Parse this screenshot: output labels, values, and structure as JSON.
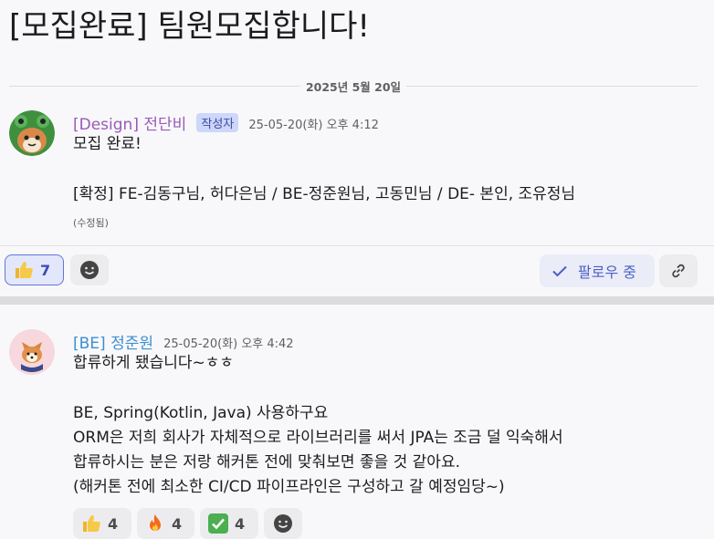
{
  "page": {
    "title": "[모집완료] 팀원모집합니다!"
  },
  "date_divider": "2025년 5월 20일",
  "messages": [
    {
      "author": "[Design] 전단비",
      "badge": "작성자",
      "time": "25-05-20(화) 오후 4:12",
      "lines": [
        "모집 완료!",
        "",
        "[확정] FE-김동구님, 허다은님 / BE-정준원님, 고동민님 / DE- 본인, 조유정님"
      ],
      "edited": "(수정됨)",
      "reactions": [
        {
          "emoji": "thumbs-up",
          "count": "7",
          "active": true
        }
      ],
      "follow_label": "팔로우 중"
    },
    {
      "author": "[BE] 정준원",
      "time": "25-05-20(화) 오후 4:42",
      "lines": [
        "합류하게 됐습니다~ㅎㅎ",
        "",
        "BE, Spring(Kotlin, Java) 사용하구요",
        "ORM은 저희 회사가 자체적으로 라이브러리를 써서 JPA는 조금 덜 익숙해서",
        "합류하시는 분은 저랑 해커톤 전에 맞춰보면 좋을 것 같아요.",
        "(해커톤 전에 최소한 CI/CD 파이프라인은 구성하고 갈 예정임당~)"
      ],
      "reactions": [
        {
          "emoji": "thumbs-up",
          "count": "4"
        },
        {
          "emoji": "fire",
          "count": "4"
        },
        {
          "emoji": "check-mark",
          "count": "4"
        }
      ]
    }
  ],
  "colors": {
    "accent": "#4a5fc4",
    "design_name": "#9a5ab8",
    "be_name": "#3d8fd1"
  }
}
